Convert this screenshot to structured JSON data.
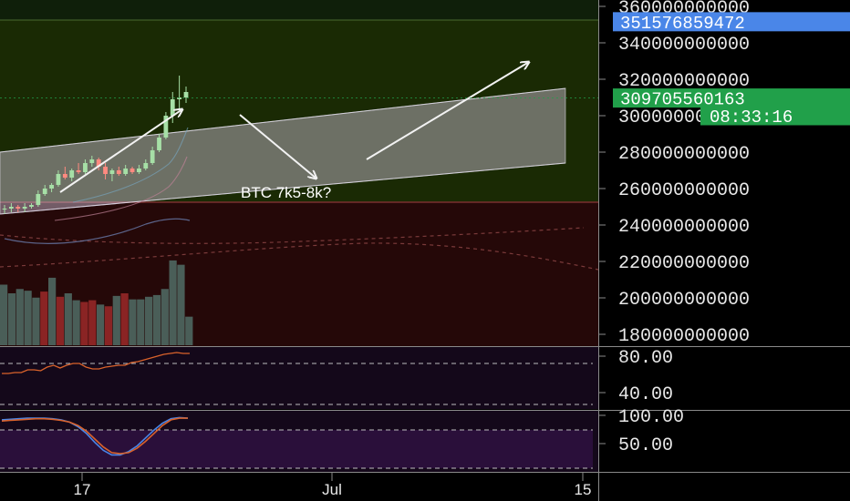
{
  "chart_data": [
    {
      "type": "candlestick",
      "panel": "price",
      "y_axis_ticks": [
        "360000000000",
        "340000000000",
        "320000000000",
        "300000000000",
        "280000000000",
        "260000000000",
        "240000000000",
        "220000000000",
        "200000000000",
        "180000000000"
      ],
      "ylim": [
        176000000000,
        360000000000
      ],
      "x_axis_ticks": [
        "17",
        "Jul",
        "15"
      ],
      "price_tags": [
        {
          "label": "351576859472",
          "value": 351576859472,
          "color": "#4a86e8"
        },
        {
          "label": "309705560163",
          "value": 309705560163,
          "color": "#21a04a"
        },
        {
          "label": "08:33:16",
          "value": 300000000000,
          "color": "#21a04a"
        }
      ],
      "annotation": "BTC 7k5-8k?",
      "candles": [
        {
          "o": 249,
          "h": 251,
          "l": 246,
          "c": 249
        },
        {
          "o": 249,
          "h": 252,
          "l": 247,
          "c": 250
        },
        {
          "o": 250,
          "h": 251,
          "l": 247,
          "c": 249
        },
        {
          "o": 249,
          "h": 252,
          "l": 247,
          "c": 250
        },
        {
          "o": 250,
          "h": 252,
          "l": 249,
          "c": 251
        },
        {
          "o": 251,
          "h": 259,
          "l": 250,
          "c": 257
        },
        {
          "o": 257,
          "h": 262,
          "l": 256,
          "c": 260
        },
        {
          "o": 260,
          "h": 263,
          "l": 258,
          "c": 262
        },
        {
          "o": 262,
          "h": 270,
          "l": 261,
          "c": 268
        },
        {
          "o": 268,
          "h": 272,
          "l": 265,
          "c": 266
        },
        {
          "o": 266,
          "h": 271,
          "l": 264,
          "c": 270
        },
        {
          "o": 270,
          "h": 274,
          "l": 268,
          "c": 269
        },
        {
          "o": 269,
          "h": 276,
          "l": 268,
          "c": 274
        },
        {
          "o": 274,
          "h": 278,
          "l": 272,
          "c": 276
        },
        {
          "o": 276,
          "h": 277,
          "l": 270,
          "c": 272
        },
        {
          "o": 272,
          "h": 274,
          "l": 265,
          "c": 268
        },
        {
          "o": 268,
          "h": 271,
          "l": 264,
          "c": 270
        },
        {
          "o": 270,
          "h": 272,
          "l": 267,
          "c": 268
        },
        {
          "o": 268,
          "h": 273,
          "l": 267,
          "c": 271
        },
        {
          "o": 271,
          "h": 272,
          "l": 268,
          "c": 269
        },
        {
          "o": 269,
          "h": 273,
          "l": 268,
          "c": 271
        },
        {
          "o": 271,
          "h": 276,
          "l": 270,
          "c": 274
        },
        {
          "o": 274,
          "h": 283,
          "l": 273,
          "c": 281
        },
        {
          "o": 281,
          "h": 290,
          "l": 280,
          "c": 288
        },
        {
          "o": 288,
          "h": 302,
          "l": 287,
          "c": 300
        },
        {
          "o": 300,
          "h": 313,
          "l": 296,
          "c": 309
        },
        {
          "o": 309,
          "h": 322,
          "l": 303,
          "c": 310
        },
        {
          "o": 310,
          "h": 316,
          "l": 307,
          "c": 313
        }
      ],
      "candle_units": "billions",
      "volume": [
        0.7,
        0.6,
        0.65,
        0.63,
        0.55,
        0.62,
        0.78,
        0.56,
        0.6,
        0.52,
        0.5,
        0.52,
        0.47,
        0.45,
        0.57,
        0.6,
        0.53,
        0.53,
        0.56,
        0.58,
        0.65,
        0.98,
        0.93,
        0.33
      ],
      "channel": {
        "lower_start": 246,
        "lower_end": 274,
        "upper_start": 280,
        "upper_end": 315
      }
    },
    {
      "type": "line",
      "panel": "indicator-1",
      "y_axis_ticks": [
        "80.00",
        "40.00"
      ],
      "ylim": [
        22,
        90
      ],
      "bands": [
        70,
        30
      ],
      "series": [
        {
          "values": [
            61,
            61,
            62,
            62,
            65,
            65,
            64,
            68,
            70,
            67,
            70,
            72,
            72,
            68,
            66,
            66,
            68,
            69,
            70,
            70,
            73,
            74,
            76,
            78,
            80,
            82,
            83,
            84,
            83,
            83
          ],
          "color": "#d9622b"
        }
      ]
    },
    {
      "type": "line",
      "panel": "indicator-2",
      "y_axis_ticks": [
        "100.00",
        "50.00"
      ],
      "ylim": [
        0,
        108
      ],
      "bands": [
        80,
        20
      ],
      "series": [
        {
          "values": [
            92,
            93,
            94,
            95,
            95,
            95,
            94,
            92,
            88,
            80,
            68,
            52,
            38,
            30,
            30,
            36,
            46,
            60,
            74,
            86,
            94,
            96,
            95
          ],
          "color": "#4a86e8"
        },
        {
          "values": [
            90,
            91,
            92,
            93,
            94,
            94,
            93,
            91,
            88,
            82,
            72,
            58,
            44,
            34,
            32,
            34,
            42,
            54,
            68,
            82,
            92,
            95,
            95
          ],
          "color": "#d9622b"
        }
      ]
    }
  ]
}
